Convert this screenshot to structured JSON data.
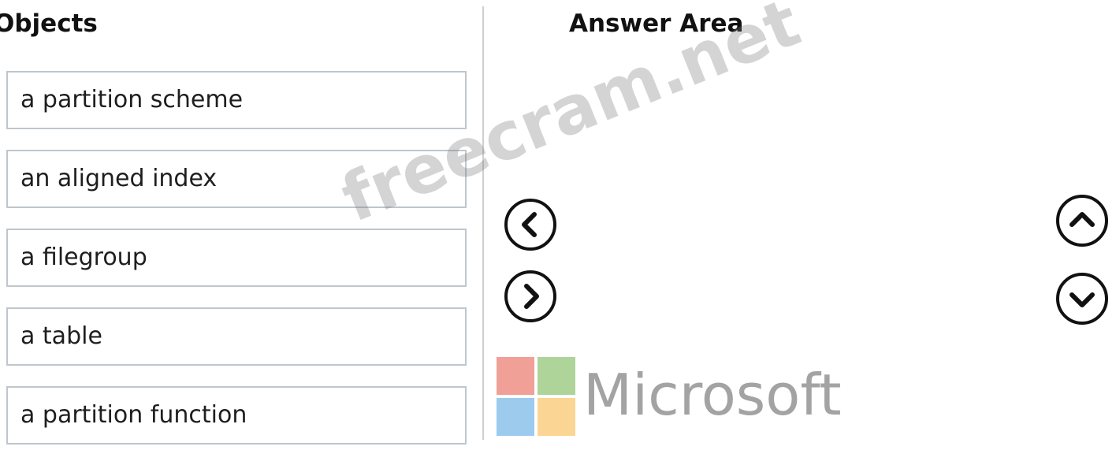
{
  "objects_panel": {
    "heading": "Objects",
    "items": [
      {
        "label": "a partition scheme"
      },
      {
        "label": "an aligned index"
      },
      {
        "label": "a filegroup"
      },
      {
        "label": "a table"
      },
      {
        "label": "a partition function"
      }
    ]
  },
  "answer_panel": {
    "heading": "Answer Area"
  },
  "controls": {
    "move_left_icon": "chevron-left-icon",
    "move_right_icon": "chevron-right-icon",
    "move_up_icon": "chevron-up-icon",
    "move_down_icon": "chevron-down-icon"
  },
  "branding": {
    "logo_text": "Microsoft",
    "logo_colors": [
      "#f0a097",
      "#aed49a",
      "#9ccbee",
      "#fbd593"
    ],
    "watermark": "freecram.net"
  }
}
